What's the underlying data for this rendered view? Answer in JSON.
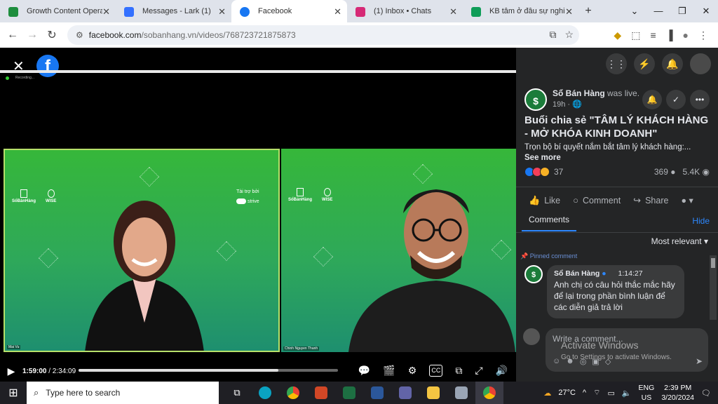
{
  "tabs": [
    {
      "label": "Growth Content Operatio",
      "color": "#1e8e3e",
      "active": false
    },
    {
      "label": "Messages - Lark (1)",
      "color": "#3370ff",
      "active": false
    },
    {
      "label": "Facebook",
      "color": "#1877f2",
      "active": true
    },
    {
      "label": "(1) Inbox • Chats",
      "color": "#d62976",
      "active": false
    },
    {
      "label": "KB tâm ở đâu sự nghiệp",
      "color": "#0f9d58",
      "active": false
    }
  ],
  "address": {
    "host": "facebook.com",
    "path": "/sobanhang.vn/videos/768723721875873"
  },
  "video": {
    "left_pane": {
      "brand1": "SổBánHàng",
      "brand2": "WISE",
      "sponsor_label": "Tài trợ bởi",
      "sponsor_name": "strive",
      "name_tag": "Mai Vu"
    },
    "right_pane": {
      "brand1": "SổBánHàng",
      "brand2": "WISE",
      "name_tag": "Chinh Nguyen Thanh"
    },
    "recording_label": "Recording...",
    "current_time": "1:59:00",
    "duration": "/ 2:34:09",
    "progress": 0.77
  },
  "post": {
    "page_name": "Sổ Bán Hàng",
    "was_live": "was live.",
    "time_ago": "19h",
    "title": "Buổi chia sẻ \"TÂM LÝ KHÁCH HÀNG - MỞ KHÓA KINH DOANH\"",
    "description": "Trọn bộ bí quyết nắm bắt tâm lý khách hàng:...",
    "see_more": "See more",
    "reactions_count": "37",
    "comments_count": "369",
    "views_count": "5.4K",
    "like_label": "Like",
    "comment_label": "Comment",
    "share_label": "Share"
  },
  "comments": {
    "tab_label": "Comments",
    "hide_label": "Hide",
    "sort_label": "Most relevant",
    "pinned_label": "Pinned comment",
    "pinned": {
      "author": "Sổ Bán Hàng",
      "timestamp": "1:14:27",
      "text": "Anh chị có câu hỏi thắc mắc hãy để lại trong phần bình luận để các diễn giả trả lời"
    },
    "placeholder": "Write a comment..."
  },
  "watermark": {
    "line1": "Activate Windows",
    "line2": "Go to Settings to activate Windows."
  },
  "taskbar": {
    "search_placeholder": "Type here to search",
    "temperature": "27°C",
    "language": "ENG",
    "region": "US",
    "time": "2:39 PM",
    "date": "3/20/2024"
  }
}
